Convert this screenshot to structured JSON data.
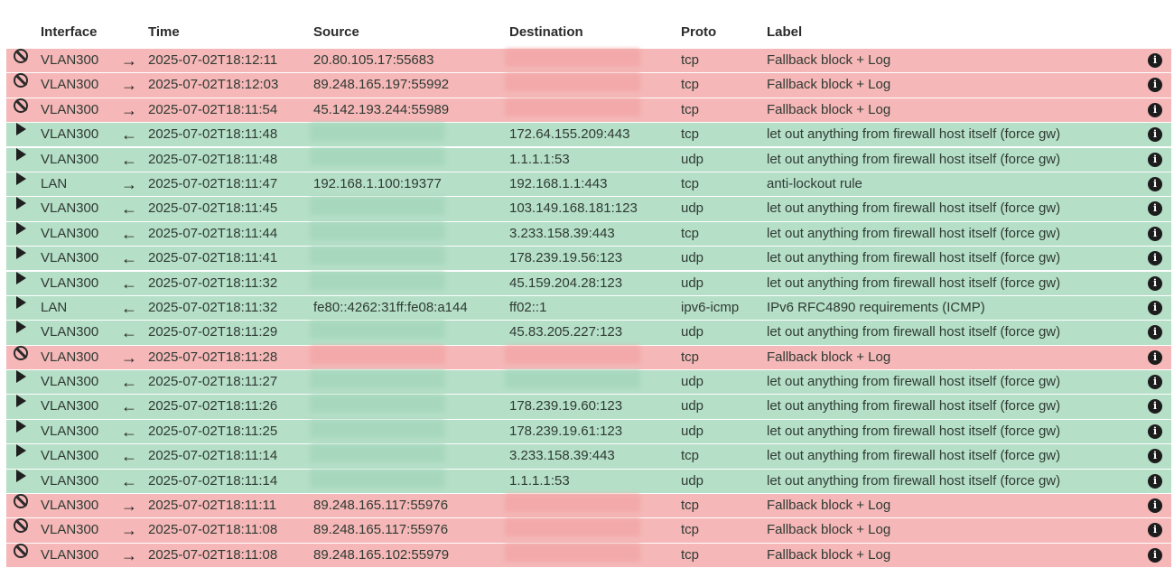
{
  "columns": {
    "interface": "Interface",
    "time": "Time",
    "source": "Source",
    "destination": "Destination",
    "proto": "Proto",
    "label": "Label"
  },
  "rows": [
    {
      "action": "block",
      "iface": "VLAN300",
      "dir": "→",
      "time": "2025-07-02T18:12:11",
      "src": "20.80.105.17:55683",
      "dst": "",
      "proto": "tcp",
      "label": "Fallback block + Log"
    },
    {
      "action": "block",
      "iface": "VLAN300",
      "dir": "→",
      "time": "2025-07-02T18:12:03",
      "src": "89.248.165.197:55992",
      "dst": "",
      "proto": "tcp",
      "label": "Fallback block + Log"
    },
    {
      "action": "block",
      "iface": "VLAN300",
      "dir": "→",
      "time": "2025-07-02T18:11:54",
      "src": "45.142.193.244:55989",
      "dst": "",
      "proto": "tcp",
      "label": "Fallback block + Log"
    },
    {
      "action": "pass",
      "iface": "VLAN300",
      "dir": "←",
      "time": "2025-07-02T18:11:48",
      "src": "",
      "dst": "172.64.155.209:443",
      "proto": "tcp",
      "label": "let out anything from firewall host itself (force gw)"
    },
    {
      "action": "pass",
      "iface": "VLAN300",
      "dir": "←",
      "time": "2025-07-02T18:11:48",
      "src": "",
      "dst": "1.1.1.1:53",
      "proto": "udp",
      "label": "let out anything from firewall host itself (force gw)"
    },
    {
      "action": "pass",
      "iface": "LAN",
      "dir": "→",
      "time": "2025-07-02T18:11:47",
      "src": "192.168.1.100:19377",
      "dst": "192.168.1.1:443",
      "proto": "tcp",
      "label": "anti-lockout rule"
    },
    {
      "action": "pass",
      "iface": "VLAN300",
      "dir": "←",
      "time": "2025-07-02T18:11:45",
      "src": "",
      "dst": "103.149.168.181:123",
      "proto": "udp",
      "label": "let out anything from firewall host itself (force gw)"
    },
    {
      "action": "pass",
      "iface": "VLAN300",
      "dir": "←",
      "time": "2025-07-02T18:11:44",
      "src": "",
      "dst": "3.233.158.39:443",
      "proto": "tcp",
      "label": "let out anything from firewall host itself (force gw)"
    },
    {
      "action": "pass",
      "iface": "VLAN300",
      "dir": "←",
      "time": "2025-07-02T18:11:41",
      "src": "",
      "dst": "178.239.19.56:123",
      "proto": "udp",
      "label": "let out anything from firewall host itself (force gw)"
    },
    {
      "action": "pass",
      "iface": "VLAN300",
      "dir": "←",
      "time": "2025-07-02T18:11:32",
      "src": "",
      "dst": "45.159.204.28:123",
      "proto": "udp",
      "label": "let out anything from firewall host itself (force gw)"
    },
    {
      "action": "pass",
      "iface": "LAN",
      "dir": "←",
      "time": "2025-07-02T18:11:32",
      "src": "fe80::4262:31ff:fe08:a144",
      "dst": "ff02::1",
      "proto": "ipv6-icmp",
      "label": "IPv6 RFC4890 requirements (ICMP)"
    },
    {
      "action": "pass",
      "iface": "VLAN300",
      "dir": "←",
      "time": "2025-07-02T18:11:29",
      "src": "",
      "dst": "45.83.205.227:123",
      "proto": "udp",
      "label": "let out anything from firewall host itself (force gw)"
    },
    {
      "action": "block",
      "iface": "VLAN300",
      "dir": "→",
      "time": "2025-07-02T18:11:28",
      "src": "",
      "dst": "",
      "proto": "tcp",
      "label": "Fallback block + Log"
    },
    {
      "action": "pass",
      "iface": "VLAN300",
      "dir": "←",
      "time": "2025-07-02T18:11:27",
      "src": "",
      "dst": "",
      "proto": "udp",
      "label": "let out anything from firewall host itself (force gw)"
    },
    {
      "action": "pass",
      "iface": "VLAN300",
      "dir": "←",
      "time": "2025-07-02T18:11:26",
      "src": "",
      "dst": "178.239.19.60:123",
      "proto": "udp",
      "label": "let out anything from firewall host itself (force gw)"
    },
    {
      "action": "pass",
      "iface": "VLAN300",
      "dir": "←",
      "time": "2025-07-02T18:11:25",
      "src": "",
      "dst": "178.239.19.61:123",
      "proto": "udp",
      "label": "let out anything from firewall host itself (force gw)"
    },
    {
      "action": "pass",
      "iface": "VLAN300",
      "dir": "←",
      "time": "2025-07-02T18:11:14",
      "src": "",
      "dst": "3.233.158.39:443",
      "proto": "tcp",
      "label": "let out anything from firewall host itself (force gw)"
    },
    {
      "action": "pass",
      "iface": "VLAN300",
      "dir": "←",
      "time": "2025-07-02T18:11:14",
      "src": "",
      "dst": "1.1.1.1:53",
      "proto": "udp",
      "label": "let out anything from firewall host itself (force gw)"
    },
    {
      "action": "block",
      "iface": "VLAN300",
      "dir": "→",
      "time": "2025-07-02T18:11:11",
      "src": "89.248.165.117:55976",
      "dst": "",
      "proto": "tcp",
      "label": "Fallback block + Log"
    },
    {
      "action": "block",
      "iface": "VLAN300",
      "dir": "→",
      "time": "2025-07-02T18:11:08",
      "src": "89.248.165.117:55976",
      "dst": "",
      "proto": "tcp",
      "label": "Fallback block + Log"
    },
    {
      "action": "block",
      "iface": "VLAN300",
      "dir": "→",
      "time": "2025-07-02T18:11:08",
      "src": "89.248.165.102:55979",
      "dst": "",
      "proto": "tcp",
      "label": "Fallback block + Log"
    }
  ],
  "info_icon_name": "info-icon",
  "colors": {
    "block_row": "#f5b7b7",
    "pass_row": "#b5dfc7"
  }
}
